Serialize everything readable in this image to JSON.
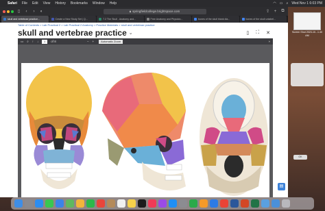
{
  "menubar": {
    "apple": "",
    "app": "Safari",
    "items": [
      "File",
      "Edit",
      "View",
      "History",
      "Bookmarks",
      "Window",
      "Help"
    ],
    "clock": "Wed Nov 1 6:03 PM"
  },
  "browser": {
    "url": "springfieldcollege.brightspace.com",
    "tabs": [
      {
        "label": "skull and vertebrae practice...",
        "active": true
      },
      {
        "label": "Create a New Study Set | Q...",
        "active": false
      },
      {
        "label": "7.2 The Skull - Anatomy and...",
        "active": false
      },
      {
        "label": "Free Anatomy and Physiolo...",
        "active": false
      },
      {
        "label": "bones of the skull blank dia...",
        "active": false
      },
      {
        "label": "bones of the skull unlabel...",
        "active": false
      }
    ],
    "breadcrumb": "Table of Contents > Lab Practical 2 > Lab Practical 2 Anatomy > Practice Materials > skull and vertebrae practice",
    "page_title": "skull and vertebrae practice",
    "title_chevron": "⌄",
    "actions": {
      "bookmark": "▯",
      "expand": "⛶",
      "close": "✕"
    }
  },
  "pdf": {
    "sidebar_toggle": "▭",
    "search": "⌕",
    "prev": "↑",
    "next": "↓",
    "page_value": "1",
    "page_total": "of 8",
    "zoom_out": "−",
    "zoom_in": "+",
    "zoom_label": "Automatic Zoom",
    "more": "»"
  },
  "desktop": {
    "screenshot_label": "Screen Shot 2023-10...1.40 AM",
    "ok_button": "OK"
  },
  "dock_apps": [
    {
      "name": "finder",
      "color": "#3f8ee6"
    },
    {
      "name": "launchpad",
      "color": "#8a8a8f"
    },
    {
      "name": "safari",
      "color": "#2c8df0"
    },
    {
      "name": "messages",
      "color": "#38c750"
    },
    {
      "name": "mail",
      "color": "#3b83e8"
    },
    {
      "name": "maps",
      "color": "#5fb85f"
    },
    {
      "name": "photos",
      "color": "#f2b53b"
    },
    {
      "name": "facetime",
      "color": "#2cb84a"
    },
    {
      "name": "calendar",
      "color": "#e9453b"
    },
    {
      "name": "contacts",
      "color": "#b48a5a"
    },
    {
      "name": "reminders",
      "color": "#f0f0f0"
    },
    {
      "name": "notes",
      "color": "#f7d24a"
    },
    {
      "name": "tv",
      "color": "#1b1b1b"
    },
    {
      "name": "music",
      "color": "#f03a57"
    },
    {
      "name": "podcasts",
      "color": "#9b4be6"
    },
    {
      "name": "app-store",
      "color": "#1f8ff5"
    },
    {
      "name": "settings",
      "color": "#8c8c91"
    },
    {
      "name": "numbers",
      "color": "#2aaa4a"
    },
    {
      "name": "pages",
      "color": "#f59a28"
    },
    {
      "name": "keynote",
      "color": "#2c7be5"
    },
    {
      "name": "chrome",
      "color": "#ea4335"
    },
    {
      "name": "word",
      "color": "#2b579a"
    },
    {
      "name": "powerpoint",
      "color": "#d24726"
    },
    {
      "name": "excel",
      "color": "#217346"
    },
    {
      "name": "preview",
      "color": "#5aa0e0"
    },
    {
      "name": "downloads",
      "color": "#4a90d9"
    },
    {
      "name": "trash",
      "color": "#b8b8bd"
    }
  ]
}
